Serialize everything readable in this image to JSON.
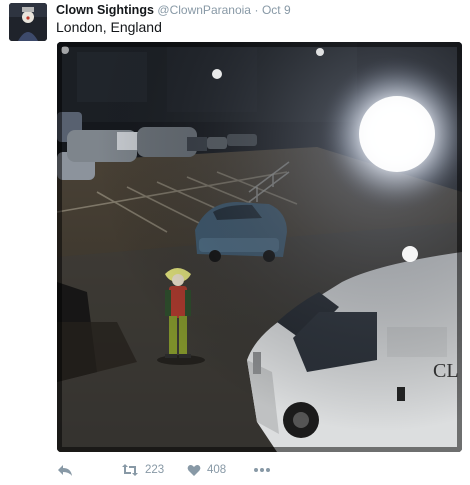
{
  "tweet": {
    "author_name": "Clown Sightings",
    "handle": "@ClownParanoia",
    "separator": "·",
    "date": "Oct 9",
    "text": "London, England"
  },
  "media": {
    "van_lettering": "CL"
  },
  "actions": {
    "retweet_count": "223",
    "like_count": "408"
  },
  "icons": [
    "reply-icon",
    "retweet-icon",
    "like-icon",
    "more-icon"
  ],
  "colors": {
    "name": "#14171a",
    "meta": "#8899a6"
  }
}
